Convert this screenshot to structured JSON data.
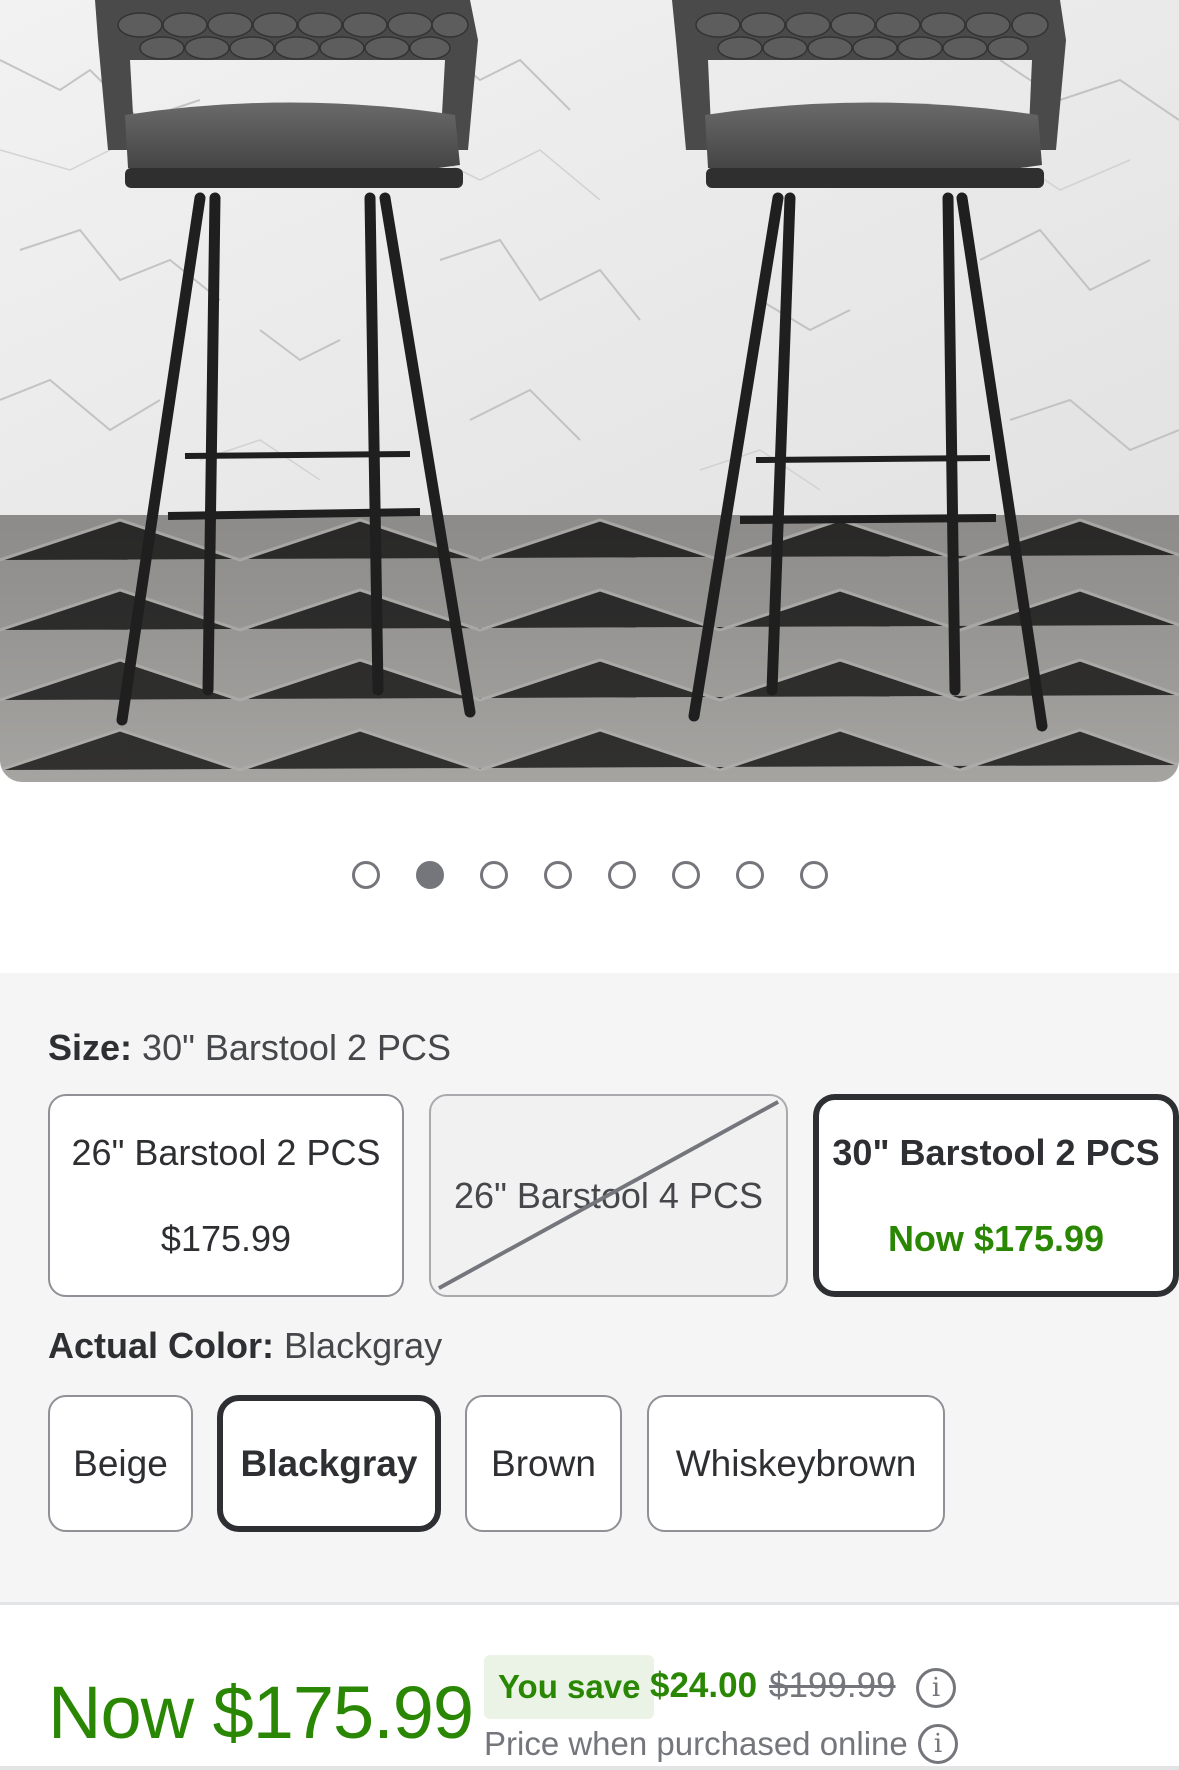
{
  "product": {
    "image_alt": "Two blackgray woven-back swivel barstools"
  },
  "carousel": {
    "count": 8,
    "active_index": 1
  },
  "size": {
    "label": "Size:",
    "selected_value": "30\" Barstool 2 PCS",
    "options": [
      {
        "name": "26\" Barstool 2 PCS",
        "price": "$175.99",
        "state": "available"
      },
      {
        "name": "26\" Barstool 4 PCS",
        "price": "",
        "state": "unavailable"
      },
      {
        "name": "30\" Barstool 2 PCS",
        "price": "Now $175.99",
        "state": "selected"
      }
    ]
  },
  "color": {
    "label": "Actual Color:",
    "selected_value": "Blackgray",
    "options": [
      {
        "name": "Beige",
        "state": "available"
      },
      {
        "name": "Blackgray",
        "state": "selected"
      },
      {
        "name": "Brown",
        "state": "available"
      },
      {
        "name": "Whiskeybrown",
        "state": "available"
      }
    ]
  },
  "pricing": {
    "now_price": "Now $175.99",
    "you_save_label": "You save",
    "save_amount": "$24.00",
    "was_price": "$199.99",
    "note": "Price when purchased online",
    "info_glyph": "i"
  },
  "colors": {
    "price_green": "#2a8703",
    "text_dark": "#2e2f32",
    "section_bg": "#f5f5f5"
  }
}
